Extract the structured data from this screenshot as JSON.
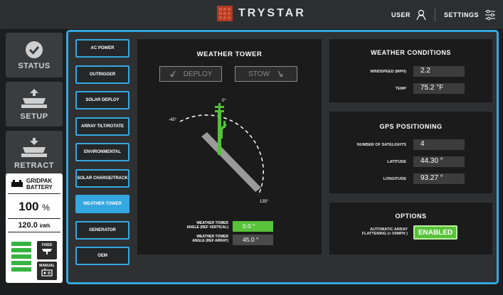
{
  "header": {
    "brand": "TRYSTAR",
    "user_label": "USER",
    "settings_label": "SETTINGS"
  },
  "nav": {
    "items": [
      {
        "label": "STATUS",
        "icon": "check-icon"
      },
      {
        "label": "SETUP",
        "icon": "setup-icon"
      },
      {
        "label": "RETRACT",
        "icon": "retract-icon"
      }
    ]
  },
  "battery": {
    "title_line1": "GRIDPAK",
    "title_line2": "BATTERY",
    "percent": "100",
    "percent_unit": "%",
    "energy": "120.0",
    "energy_unit": "kWh",
    "level_fraction": 1.0,
    "mode_fixed": "FIXED",
    "mode_manual": "MANUAL"
  },
  "subnav": {
    "items": [
      "AC POWER",
      "OUTRIGGER",
      "SOLAR DEPLOY",
      "ARRAY TILT/ROTATE",
      "ENVIRONMENTAL",
      "SOLAR CHARGE/TRACK",
      "WEATHER TOWER",
      "GENERATOR",
      "OEM"
    ],
    "active": "WEATHER TOWER"
  },
  "tower": {
    "title": "WEATHER TOWER",
    "deploy_label": "DEPLOY",
    "stow_label": "STOW",
    "angle_0": "0°",
    "angle_neg45": "-45°",
    "angle_135": "135°",
    "angle_vertical_label_1": "WEATHER TOWER",
    "angle_vertical_label_2": "ANGLE (REF VERTICAL)",
    "angle_vertical_value": "0.0 °",
    "angle_array_label_1": "WEATHER TOWER",
    "angle_array_label_2": "ANGLE (REF ARRAY)",
    "angle_array_value": "45.0 °"
  },
  "weather": {
    "title": "WEATHER CONDITIONS",
    "windspeed_label": "WINDSPEED (MPH)",
    "windspeed_value": "2.2",
    "temp_label": "TEMP",
    "temp_value": "75.2 °F"
  },
  "gps": {
    "title": "GPS POSITIONING",
    "satellites_label": "NUMBER OF SATELIGHTS",
    "satellites_value": "4",
    "latitude_label": "LATITUDE",
    "latitude_value": "44.30 °",
    "longitude_label": "LONGITUDE",
    "longitude_value": "93.27 °"
  },
  "options": {
    "title": "OPTIONS",
    "flatten_label_1": "AUTOMATIC ARRAY",
    "flatten_label_2": "FLATTENING (> 50MPH )",
    "flatten_value": "ENABLED"
  },
  "colors": {
    "accent": "#35a7e0",
    "active_green": "#58c23a",
    "brand_red": "#b03a24"
  }
}
